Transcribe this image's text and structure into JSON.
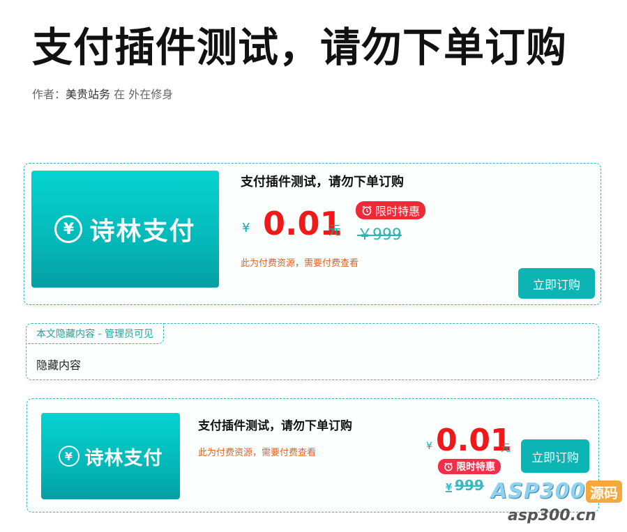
{
  "page": {
    "title": "支付插件测试，请勿下单订购",
    "byline_prefix": "作者：",
    "author": "美贵站务",
    "byline_suffix": " 在 外在修身"
  },
  "card1": {
    "cover_icon": "yen-coin-icon",
    "cover_symbol": "¥",
    "cover_text": "诗林支付",
    "title": "支付插件测试，请勿下单订购",
    "currency": "¥",
    "price": "0.01",
    "unit": "元",
    "badge": "限时特惠",
    "original_price": "￥999",
    "note": "此为付费资源，需要付费查看",
    "button": "立即订购"
  },
  "hidden": {
    "tab_label": "本文隐藏内容 - 管理员可见",
    "content": "隐藏内容"
  },
  "card2": {
    "cover_symbol": "¥",
    "cover_text": "诗林支付",
    "title": "支付插件测试，请勿下单订购",
    "note": "此为付费资源，需要付费查看",
    "currency": "¥",
    "price": "0.01",
    "unit": "元",
    "badge": "限时特惠",
    "original_currency": "¥",
    "original_price": "999",
    "button": "立即订购"
  },
  "watermark": {
    "brand": "ASP300",
    "badge": "源码",
    "url": "asp300.cn"
  },
  "colors": {
    "accent": "#0cb5b4",
    "price": "#f01818",
    "badge": "#f02838",
    "note": "#d9622a"
  }
}
